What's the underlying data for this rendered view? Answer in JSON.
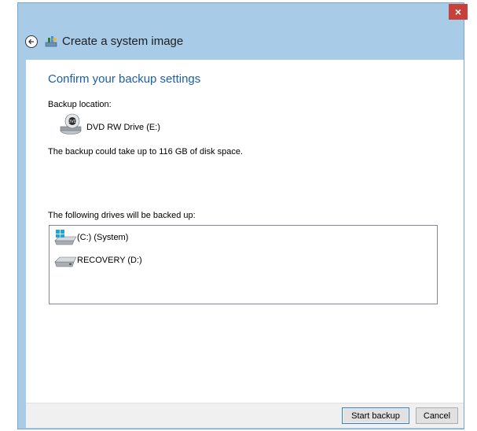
{
  "window": {
    "close_label": "×",
    "title": "Create a system image"
  },
  "main": {
    "heading": "Confirm your backup settings",
    "backup_location_label": "Backup location:",
    "backup_location_value": "DVD RW Drive (E:)",
    "disk_space_note": "The backup could take up to 116 GB of disk space.",
    "drives_label": "The following drives will be backed up:",
    "drives": [
      {
        "label": "(C:) (System)",
        "icon": "system-drive-icon"
      },
      {
        "label": "RECOVERY (D:)",
        "icon": "hard-drive-icon"
      }
    ]
  },
  "footer": {
    "start_label": "Start backup",
    "cancel_label": "Cancel"
  },
  "colors": {
    "window_frame": "#a8cbe8",
    "heading": "#1c5fa6",
    "close_button": "#c7403a"
  }
}
